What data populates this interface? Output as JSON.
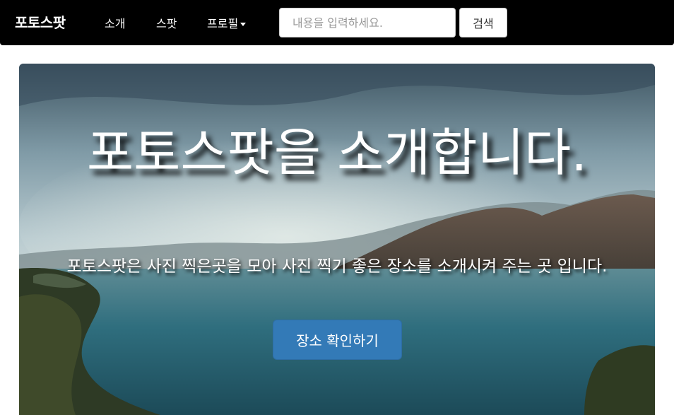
{
  "navbar": {
    "brand": "포토스팟",
    "items": [
      {
        "label": "소개"
      },
      {
        "label": "스팟"
      },
      {
        "label": "프로필"
      }
    ],
    "search": {
      "placeholder": "내용을 입력하세요.",
      "value": "",
      "button_label": "검색"
    }
  },
  "hero": {
    "title": "포토스팟을 소개합니다.",
    "subtitle": "포토스팟은 사진 찍은곳을 모아 사진 찍기 좋은 장소를 소개시켜 주는 곳 입니다.",
    "button_label": "장소 확인하기"
  },
  "colors": {
    "navbar_bg": "#000000",
    "primary_button": "#337ab7"
  },
  "icons": {
    "dropdown": "caret-down-icon"
  }
}
